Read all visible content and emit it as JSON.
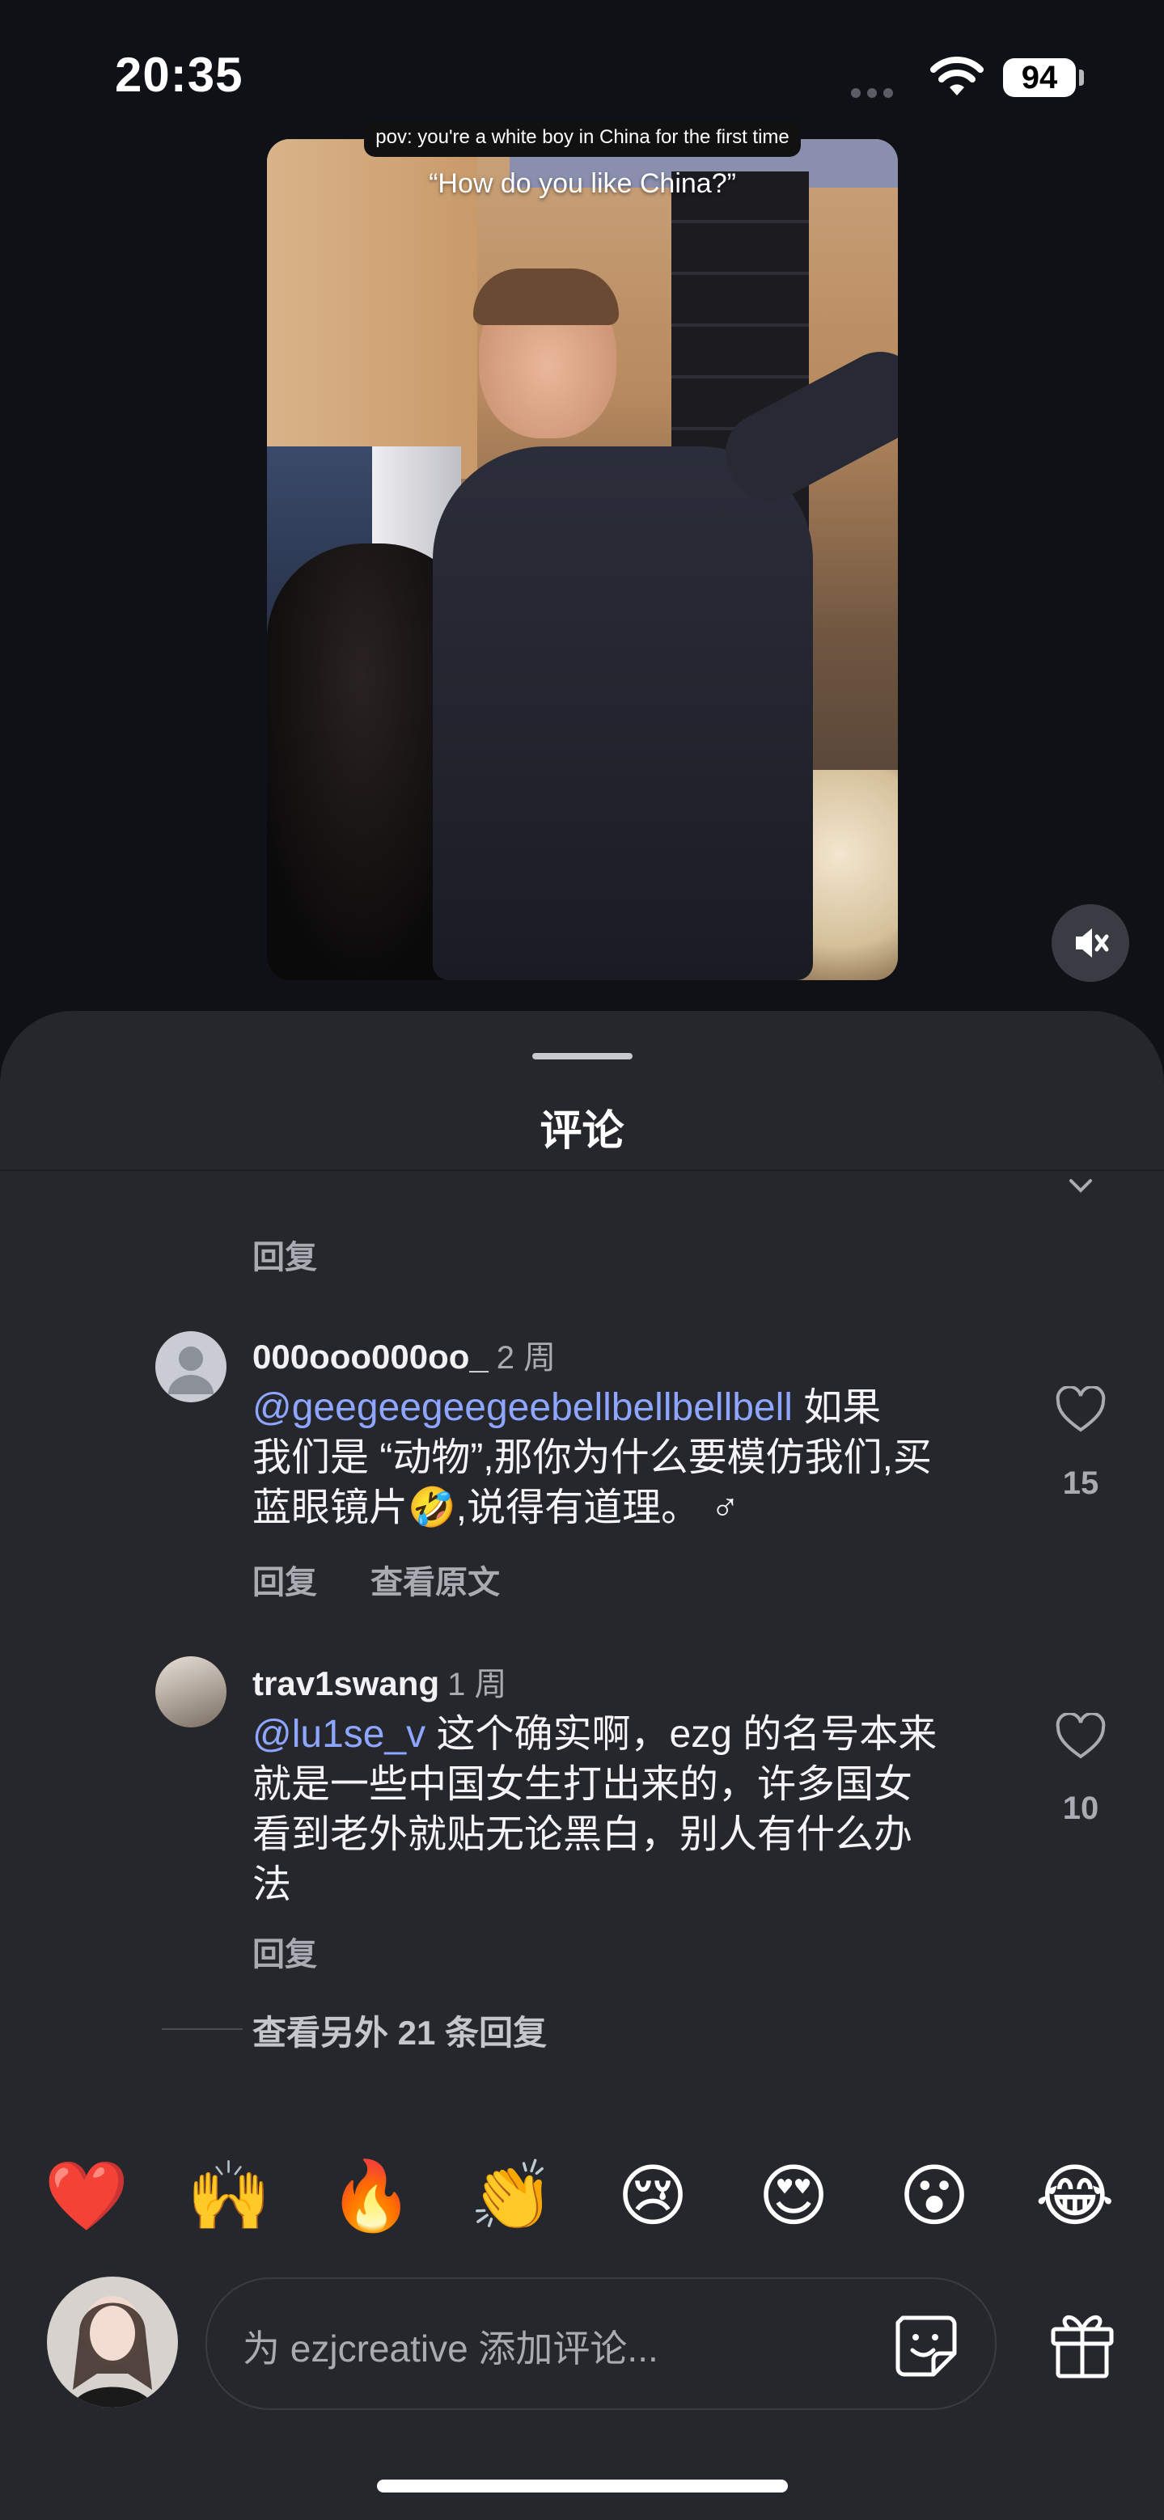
{
  "status": {
    "time": "20:35",
    "battery": "94"
  },
  "video": {
    "caption_top": "pov: you're a white boy in China for the first time",
    "caption_quote": "“How do you like China?”"
  },
  "sheet": {
    "title": "评论",
    "prev_reply_label": "回复"
  },
  "comments": [
    {
      "username": "000ooo000oo_",
      "age": "2 周",
      "mention": "@geegeegeegeebellbellbellbell",
      "text_line1": " 如果",
      "text_line2": "我们是 “动物”,那你为什么要模仿我们,买",
      "text_line3": "蓝眼镜片🤣,说得有道理。 ♂",
      "likes": "15",
      "reply_label": "回复",
      "translate_label": "查看原文"
    },
    {
      "username": "trav1swang",
      "age": "1 周",
      "mention": "@lu1se_v",
      "text_line1": " 这个确实啊，ezg 的名号本来",
      "text_line2": "就是一些中国女生打出来的，许多国女",
      "text_line3": "看到老外就贴无论黑白，别人有什么办",
      "text_line4": "法",
      "likes": "10",
      "reply_label": "回复"
    }
  ],
  "more_replies": "查看另外 21 条回复",
  "emojis": [
    "❤️",
    "🙌",
    "🔥",
    "👏",
    "😢",
    "😍",
    "😮",
    "😂"
  ],
  "composer": {
    "placeholder": "为 ezjcreative 添加评论..."
  },
  "colors": {
    "background": "#0f1117",
    "sheet": "#25272c",
    "mention": "#8ea6ff",
    "muted_text": "#a9abb2"
  }
}
